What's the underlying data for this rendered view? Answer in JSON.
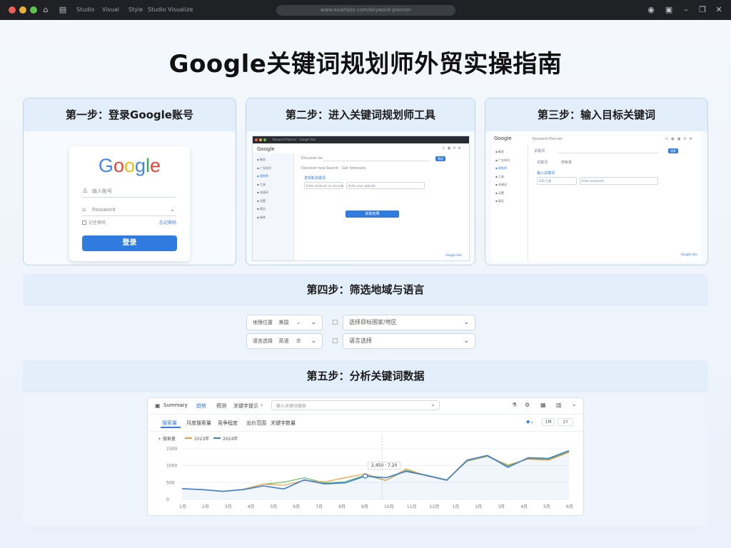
{
  "window": {
    "menu": [
      "Studio",
      "Visual",
      "Style",
      "Studio Visualize"
    ],
    "address": "www.example.com/keyword-planner"
  },
  "title": "Google关键词规划师外贸实操指南",
  "step1": {
    "heading": "第一步：登录Google账号",
    "logo": "Google",
    "username_placeholder": "输入账号",
    "password_placeholder": "Password",
    "remember": "记住密码",
    "forgot": "忘记密码",
    "login_button": "登录"
  },
  "step2": {
    "heading": "第二步：进入关键词规划师工具",
    "logo": "Google",
    "address": "Keyword Planner - Google Ads",
    "side_items": [
      "概览",
      "广告系列",
      "规划师",
      "工具",
      "关键词",
      "设置",
      "报告",
      "账单"
    ],
    "tabs": [
      "Discover new",
      "Search",
      "Get forecasts"
    ],
    "section_label": "发现新关键词",
    "input1": "Enter products or services",
    "input2": "Enter your website",
    "button": "获取结果",
    "filter_button": "筛选",
    "footer": "Google Ads"
  },
  "step3": {
    "heading": "第三步：输入目标关键词",
    "logo": "Google",
    "address": "Keyword Planner",
    "side_items": [
      "概览",
      "广告系列",
      "规划师",
      "工具",
      "关键词",
      "设置",
      "报告"
    ],
    "tabs": [
      "关键词",
      "搜索量"
    ],
    "section_label": "输入关键词",
    "input1": "LED 灯具",
    "input2": "Enter keywords",
    "button": "搜索",
    "footer": "Google Ads"
  },
  "step4": {
    "heading": "第四步：筛选地域与语言",
    "location_label": "地理位置",
    "location_value": "美国",
    "language_label": "语言选择",
    "language_value": "英语",
    "dropdown1": "选择目标国家/地区",
    "dropdown2": "语言选择"
  },
  "step5": {
    "heading": "第五步：分析关键词数据",
    "toolbar_title": "Summary",
    "toolbar_tabs": [
      "趋势",
      "预测",
      "关键字提示"
    ],
    "search_placeholder": "输入关键词搜索",
    "subtabs": [
      "搜索量",
      "月度搜索量",
      "竞争程度",
      "出价范围",
      "关键字数量"
    ],
    "legend_title": "+ 搜索量",
    "buttons": [
      "1M",
      "1Y"
    ],
    "tooltip": "2,450 · 7.20"
  },
  "chart_data": {
    "type": "line",
    "categories": [
      "1月",
      "2月",
      "3月",
      "4月",
      "5月",
      "6月",
      "7月",
      "8月",
      "9月",
      "10月",
      "11月",
      "12月",
      "1月",
      "2月",
      "3月",
      "4月",
      "5月",
      "6月"
    ],
    "yticks": [
      0,
      500,
      1000,
      1500
    ],
    "ylim": [
      0,
      1600
    ],
    "series": [
      {
        "name": "2023年",
        "color": "#f29b38",
        "values": [
          320,
          290,
          240,
          300,
          450,
          420,
          560,
          520,
          640,
          760,
          560,
          900,
          700,
          560,
          1140,
          1280,
          1020,
          1190,
          1160,
          1390
        ]
      },
      {
        "name": "2024年",
        "color": "#3a7fd6",
        "values": [
          320,
          290,
          240,
          290,
          400,
          310,
          580,
          460,
          490,
          690,
          640,
          830,
          710,
          570,
          1160,
          1300,
          950,
          1230,
          1210,
          1440
        ]
      },
      {
        "name": "",
        "color": "#5fbf5a",
        "values": [
          null,
          null,
          null,
          300,
          450,
          510,
          640,
          490,
          520,
          720,
          560,
          860,
          720,
          580,
          1130,
          1270,
          990,
          1210,
          1180,
          1420
        ]
      }
    ],
    "grid": true,
    "legend": "top-left"
  },
  "colors": {
    "accent": "#2f7be0",
    "header_bg": "#e3eefb",
    "border": "#bcd3ee"
  }
}
